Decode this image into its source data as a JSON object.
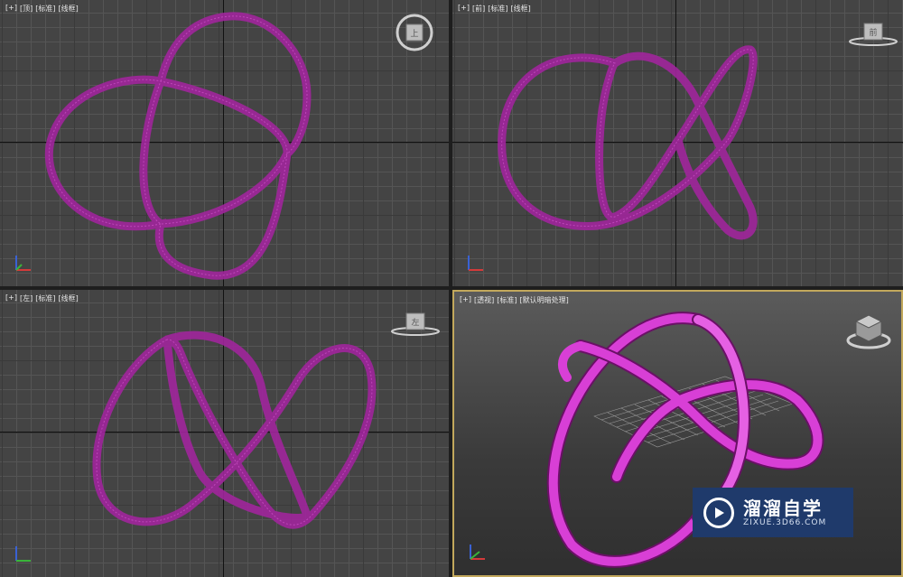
{
  "viewports": {
    "top": {
      "plus": "[+]",
      "view": "[顶]",
      "shading": "[标准]",
      "mode": "[线框]",
      "cube_face": "上"
    },
    "front": {
      "plus": "[+]",
      "view": "[前]",
      "shading": "[标准]",
      "mode": "[线框]",
      "cube_face": "前"
    },
    "left": {
      "plus": "[+]",
      "view": "[左]",
      "shading": "[标准]",
      "mode": "[线框]",
      "cube_face": "左"
    },
    "perspective": {
      "plus": "[+]",
      "view": "[透视]",
      "shading": "[标准]",
      "mode": "[默认明暗处理]"
    }
  },
  "watermark": {
    "title": "溜溜自学",
    "url": "ZIXUE.3D66.COM"
  },
  "colors": {
    "knot": "#a0259c",
    "knot_shaded": "#d83fd6",
    "active_border": "#c2a85c",
    "watermark_bg": "#1f3a6b"
  },
  "icons": {
    "view_cube": "view-cube-icon",
    "axis_tripod": "axis-tripod-icon",
    "logo": "play-logo-icon"
  }
}
